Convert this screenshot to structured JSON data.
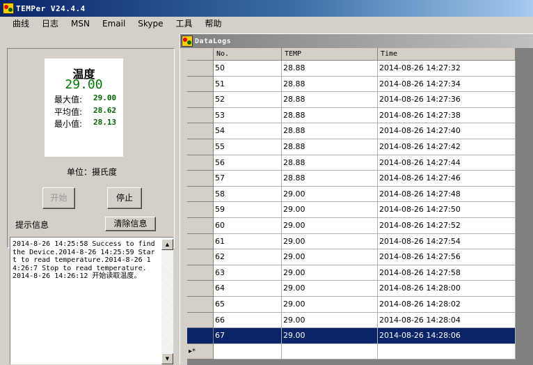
{
  "window": {
    "title": "TEMPer V24.4.4"
  },
  "menu": [
    "曲线",
    "日志",
    "MSN",
    "Email",
    "Skype",
    "工具",
    "帮助"
  ],
  "temperature": {
    "title": "温度",
    "current": "29.00",
    "max_label": "最大值:",
    "max_value": "29.00",
    "avg_label": "平均值:",
    "avg_value": "28.62",
    "min_label": "最小值:",
    "min_value": "28.13",
    "unit": "单位：摄氏度"
  },
  "controls": {
    "start_label": "开始",
    "stop_label": "停止",
    "info_label": "提示信息",
    "clear_label": "清除信息"
  },
  "log": {
    "text": "2014-8-26 14:25:58 Success to find the Device.2014-8-26 14:25:59 Start to read temperature.2014-8-26 14:26:7 Stop to read temperature.\n2014-8-26 14:26:12 开始读取温度。"
  },
  "datalogs": {
    "title": "DataLogs",
    "columns": [
      "No.",
      "TEMP",
      "Time"
    ],
    "rows": [
      [
        "50",
        "28.88",
        "2014-08-26 14:27:32"
      ],
      [
        "51",
        "28.88",
        "2014-08-26 14:27:34"
      ],
      [
        "52",
        "28.88",
        "2014-08-26 14:27:36"
      ],
      [
        "53",
        "28.88",
        "2014-08-26 14:27:38"
      ],
      [
        "54",
        "28.88",
        "2014-08-26 14:27:40"
      ],
      [
        "55",
        "28.88",
        "2014-08-26 14:27:42"
      ],
      [
        "56",
        "28.88",
        "2014-08-26 14:27:44"
      ],
      [
        "57",
        "28.88",
        "2014-08-26 14:27:46"
      ],
      [
        "58",
        "29.00",
        "2014-08-26 14:27:48"
      ],
      [
        "59",
        "29.00",
        "2014-08-26 14:27:50"
      ],
      [
        "60",
        "29.00",
        "2014-08-26 14:27:52"
      ],
      [
        "61",
        "29.00",
        "2014-08-26 14:27:54"
      ],
      [
        "62",
        "29.00",
        "2014-08-26 14:27:56"
      ],
      [
        "63",
        "29.00",
        "2014-08-26 14:27:58"
      ],
      [
        "64",
        "29.00",
        "2014-08-26 14:28:00"
      ],
      [
        "65",
        "29.00",
        "2014-08-26 14:28:02"
      ],
      [
        "66",
        "29.00",
        "2014-08-26 14:28:04"
      ],
      [
        "67",
        "29.00",
        "2014-08-26 14:28:06"
      ]
    ],
    "selected_row": 17,
    "new_row_marker": "▸*"
  },
  "colors": {
    "value_green": "#007700",
    "selection": "#0a246a"
  }
}
